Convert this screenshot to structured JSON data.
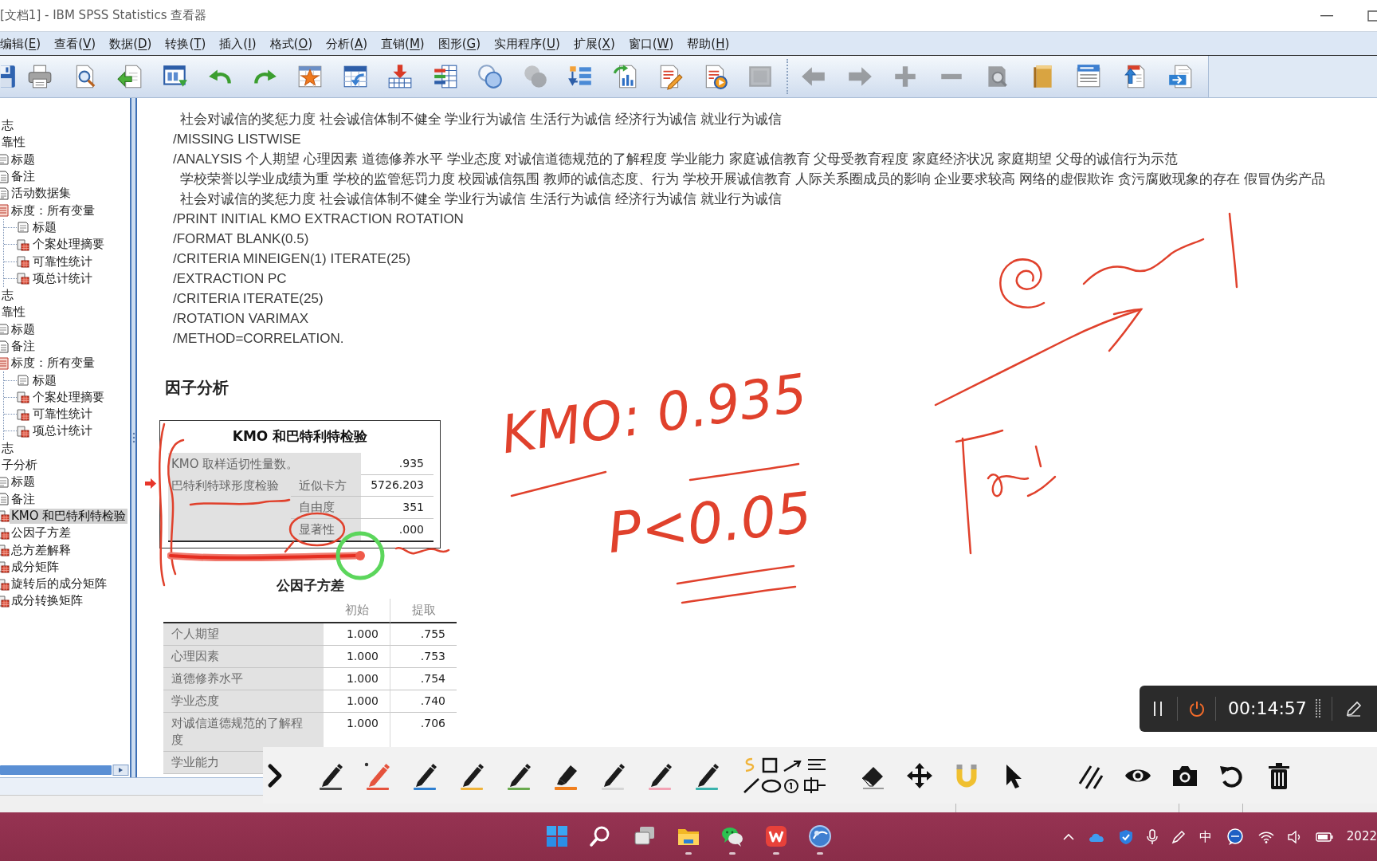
{
  "window": {
    "title": "[文档1] - IBM SPSS Statistics 查看器"
  },
  "menu": [
    "编辑(E)",
    "查看(V)",
    "数据(D)",
    "转换(T)",
    "插入(I)",
    "格式(O)",
    "分析(A)",
    "直销(M)",
    "图形(G)",
    "实用程序(U)",
    "扩展(X)",
    "窗口(W)",
    "帮助(H)"
  ],
  "toolbar": {
    "groups": [
      [
        {
          "kind": "save",
          "disabled": false
        },
        {
          "kind": "print",
          "disabled": false
        },
        {
          "kind": "preview",
          "disabled": false
        },
        {
          "kind": "export",
          "disabled": false
        },
        {
          "kind": "recall",
          "disabled": false
        },
        {
          "kind": "undo",
          "disabled": false
        },
        {
          "kind": "redo",
          "disabled": false
        },
        {
          "kind": "goto_data",
          "disabled": false
        },
        {
          "kind": "goto_case",
          "disabled": false
        },
        {
          "kind": "goto_variable",
          "disabled": false
        },
        {
          "kind": "variables",
          "disabled": false
        },
        {
          "kind": "use_sets",
          "disabled": false
        },
        {
          "kind": "show_all",
          "disabled": true
        },
        {
          "kind": "designate",
          "disabled": false
        },
        {
          "kind": "chart",
          "disabled": false
        },
        {
          "kind": "edit",
          "disabled": false
        },
        {
          "kind": "script",
          "disabled": false
        },
        {
          "kind": "frame",
          "disabled": true
        }
      ],
      [
        {
          "kind": "back",
          "disabled": true
        },
        {
          "kind": "forward",
          "disabled": true
        },
        {
          "kind": "expand",
          "disabled": true
        },
        {
          "kind": "collapse",
          "disabled": true
        },
        {
          "kind": "inspect",
          "disabled": true
        },
        {
          "kind": "book",
          "disabled": false
        },
        {
          "kind": "title",
          "disabled": false
        },
        {
          "kind": "upload",
          "disabled": false
        },
        {
          "kind": "transfer",
          "disabled": false
        }
      ]
    ]
  },
  "outline": {
    "items": [
      {
        "label": "志",
        "selected": false
      },
      {
        "label": "靠性",
        "selected": false,
        "children": [
          {
            "label": "标题",
            "kind": "title",
            "selected": false
          },
          {
            "label": "备注",
            "kind": "notes",
            "selected": false
          },
          {
            "label": "活动数据集",
            "kind": "dataset",
            "selected": false
          },
          {
            "label": "标度：所有变量",
            "kind": "scale",
            "selected": false,
            "children": [
              {
                "label": "标题",
                "kind": "title",
                "selected": false
              },
              {
                "label": "个案处理摘要",
                "kind": "table",
                "selected": false
              },
              {
                "label": "可靠性统计",
                "kind": "table",
                "selected": false
              },
              {
                "label": "项总计统计",
                "kind": "table",
                "selected": false
              }
            ]
          }
        ]
      },
      {
        "label": "志",
        "selected": false
      },
      {
        "label": "靠性",
        "selected": false,
        "children": [
          {
            "label": "标题",
            "kind": "title",
            "selected": false
          },
          {
            "label": "备注",
            "kind": "notes",
            "selected": false
          },
          {
            "label": "标度：所有变量",
            "kind": "scale",
            "selected": false,
            "children": [
              {
                "label": "标题",
                "kind": "title",
                "selected": false
              },
              {
                "label": "个案处理摘要",
                "kind": "table",
                "selected": false
              },
              {
                "label": "可靠性统计",
                "kind": "table",
                "selected": false
              },
              {
                "label": "项总计统计",
                "kind": "table",
                "selected": false
              }
            ]
          }
        ]
      },
      {
        "label": "志",
        "selected": false
      },
      {
        "label": "子分析",
        "selected": false,
        "children": [
          {
            "label": "标题",
            "kind": "title",
            "selected": false
          },
          {
            "label": "备注",
            "kind": "notes",
            "selected": false
          },
          {
            "label": "KMO 和巴特利特检验",
            "kind": "table",
            "selected": true
          },
          {
            "label": "公因子方差",
            "kind": "table",
            "selected": false
          },
          {
            "label": "总方差解释",
            "kind": "table",
            "selected": false
          },
          {
            "label": "成分矩阵",
            "kind": "table",
            "selected": false
          },
          {
            "label": "旋转后的成分矩阵",
            "kind": "table",
            "selected": false
          },
          {
            "label": "成分转换矩阵",
            "kind": "table",
            "selected": false
          }
        ]
      }
    ]
  },
  "syntax": [
    {
      "kind": "continuation",
      "text": "社会对诚信的奖惩力度 社会诚信体制不健全 学业行为诚信 生活行为诚信 经济行为诚信 就业行为诚信"
    },
    {
      "kind": "command",
      "text": "/MISSING LISTWISE"
    },
    {
      "kind": "command",
      "text": "/ANALYSIS 个人期望 心理因素 道德修养水平 学业态度 对诚信道德规范的了解程度 学业能力 家庭诚信教育 父母受教育程度 家庭经济状况 家庭期望 父母的诚信行为示范"
    },
    {
      "kind": "continuation",
      "text": "学校荣誉以学业成绩为重 学校的监管惩罚力度 校园诚信氛围 教师的诚信态度、行为 学校开展诚信教育 人际关系圈成员的影响 企业要求较高 网络的虚假欺诈 贪污腐败现象的存在 假冒伪劣产品"
    },
    {
      "kind": "continuation",
      "text": "社会对诚信的奖惩力度 社会诚信体制不健全 学业行为诚信 生活行为诚信 经济行为诚信 就业行为诚信"
    },
    {
      "kind": "command",
      "text": "/PRINT INITIAL KMO EXTRACTION ROTATION"
    },
    {
      "kind": "command",
      "text": "/FORMAT BLANK(0.5)"
    },
    {
      "kind": "command",
      "text": "/CRITERIA MINEIGEN(1) ITERATE(25)"
    },
    {
      "kind": "command",
      "text": "/EXTRACTION PC"
    },
    {
      "kind": "command",
      "text": "/CRITERIA ITERATE(25)"
    },
    {
      "kind": "command",
      "text": "/ROTATION VARIMAX"
    },
    {
      "kind": "command",
      "text": "/METHOD=CORRELATION."
    }
  ],
  "output": {
    "heading": "因子分析",
    "kmo_table": {
      "title": "KMO 和巴特利特检验",
      "rows": [
        {
          "label": "KMO 取样适切性量数。",
          "value": ".935"
        },
        {
          "label": "巴特利特球形度检验",
          "subrows": [
            {
              "label": "近似卡方",
              "value": "5726.203"
            },
            {
              "label": "自由度",
              "value": "351"
            },
            {
              "label": "显著性",
              "value": ".000"
            }
          ]
        }
      ]
    },
    "communalities": {
      "title": "公因子方差",
      "columns": [
        "初始",
        "提取"
      ],
      "rows": [
        {
          "label": "个人期望",
          "values": [
            "1.000",
            ".755"
          ]
        },
        {
          "label": "心理因素",
          "values": [
            "1.000",
            ".753"
          ]
        },
        {
          "label": "道德修养水平",
          "values": [
            "1.000",
            ".754"
          ]
        },
        {
          "label": "学业态度",
          "values": [
            "1.000",
            ".740"
          ]
        },
        {
          "label": "对诚信道德规范的了解程度",
          "values": [
            "1.000",
            ".706"
          ]
        },
        {
          "label": "学业能力"
        }
      ]
    }
  },
  "handwritten_notes": [
    "KMO: 0.935",
    "P<0.05"
  ],
  "recorder": {
    "time": "00:14:57"
  },
  "pen_toolbar": {
    "tools": [
      {
        "kind": "collapse"
      },
      {
        "kind": "pen",
        "color": "#4a4a4a",
        "selected": false
      },
      {
        "kind": "pen",
        "color": "#e5533d",
        "selected": true
      },
      {
        "kind": "pen",
        "color": "#2f80d1",
        "selected": false
      },
      {
        "kind": "pen",
        "color": "#f0b43c",
        "selected": false
      },
      {
        "kind": "pen",
        "color": "#6aaa4f",
        "selected": false
      },
      {
        "kind": "highlighter",
        "color": "#f07f1e",
        "selected": false
      },
      {
        "kind": "pen",
        "color": "#d6d6d6",
        "selected": false
      },
      {
        "kind": "pen",
        "color": "#f3a3b5",
        "selected": false
      },
      {
        "kind": "pen",
        "color": "#3bb3ad",
        "selected": false
      },
      {
        "kind": "shapes",
        "selected": false
      },
      {
        "kind": "eraser",
        "selected": false
      },
      {
        "kind": "move",
        "selected": false
      },
      {
        "kind": "magnet",
        "selected": false
      },
      {
        "kind": "pointer",
        "selected": false
      },
      {
        "kind": "lines",
        "selected": false
      },
      {
        "kind": "eye"
      },
      {
        "kind": "camera"
      },
      {
        "kind": "undo"
      },
      {
        "kind": "trash"
      }
    ]
  },
  "taskbar": {
    "apps": [
      {
        "kind": "start",
        "running": false
      },
      {
        "kind": "search",
        "running": false
      },
      {
        "kind": "task_view",
        "running": false
      },
      {
        "kind": "explorer",
        "running": true
      },
      {
        "kind": "chat",
        "running": true
      },
      {
        "kind": "office",
        "running": true
      },
      {
        "kind": "stats",
        "running": true
      }
    ],
    "tray": {
      "input_method": "中",
      "clock": "2022"
    }
  }
}
